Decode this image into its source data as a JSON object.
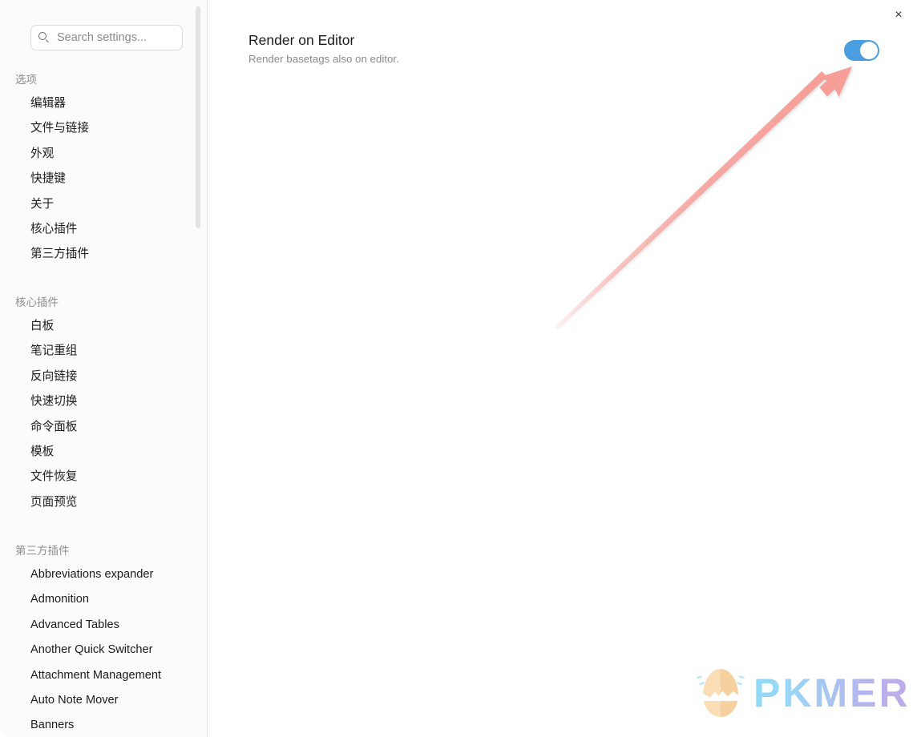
{
  "window": {
    "close_label": "×"
  },
  "search": {
    "placeholder": "Search settings...",
    "value": "",
    "icon": "search-icon"
  },
  "sidebar": {
    "sections": [
      {
        "title": "选项",
        "items": [
          {
            "label": "编辑器"
          },
          {
            "label": "文件与链接"
          },
          {
            "label": "外观"
          },
          {
            "label": "快捷键"
          },
          {
            "label": "关于"
          },
          {
            "label": "核心插件"
          },
          {
            "label": "第三方插件"
          }
        ]
      },
      {
        "title": "核心插件",
        "items": [
          {
            "label": "白板"
          },
          {
            "label": "笔记重组"
          },
          {
            "label": "反向链接"
          },
          {
            "label": "快速切换"
          },
          {
            "label": "命令面板"
          },
          {
            "label": "模板"
          },
          {
            "label": "文件恢复"
          },
          {
            "label": "页面预览"
          }
        ]
      },
      {
        "title": "第三方插件",
        "items": [
          {
            "label": "Abbreviations expander"
          },
          {
            "label": "Admonition"
          },
          {
            "label": "Advanced Tables"
          },
          {
            "label": "Another Quick Switcher"
          },
          {
            "label": "Attachment Management"
          },
          {
            "label": "Auto Note Mover"
          },
          {
            "label": "Banners"
          }
        ]
      }
    ]
  },
  "main": {
    "setting": {
      "name": "Render on Editor",
      "description": "Render basetags also on editor.",
      "toggle_state": "on"
    }
  },
  "watermark": {
    "text": "PKMER"
  },
  "colors": {
    "toggle_on": "#4a9ee0",
    "arrow": "#f79e98",
    "sidebar_bg": "#fbfbfb",
    "main_bg": "#ffffff",
    "section_title": "#8d8d8d",
    "item_text": "#1c1c1c",
    "desc_text": "#8a8a8a"
  }
}
